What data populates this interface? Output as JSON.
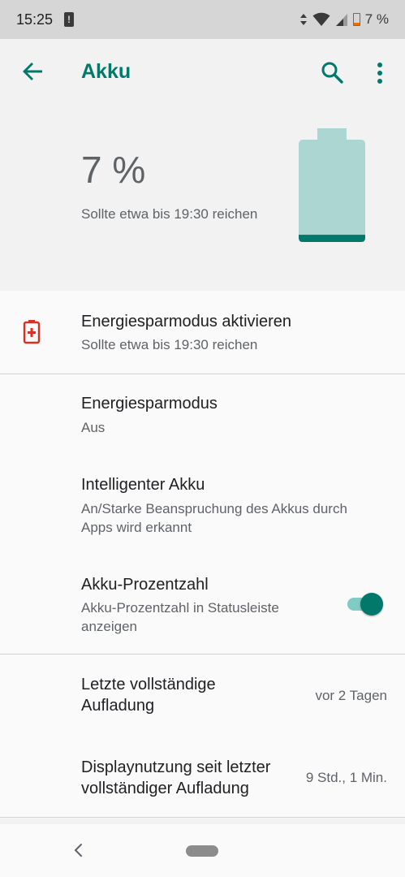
{
  "status_bar": {
    "time": "15:25",
    "battery_percent": "7 %",
    "icons": [
      "alert-icon",
      "data-arrows-icon",
      "wifi-icon",
      "signal-icon",
      "battery-icon"
    ]
  },
  "toolbar": {
    "title": "Akku",
    "back_icon": "arrow-left-icon",
    "search_icon": "search-icon",
    "more_icon": "more-vert-icon"
  },
  "header": {
    "percent": "7 %",
    "estimate": "Sollte etwa bis 19:30 reichen",
    "battery_level": 0.07
  },
  "items": [
    {
      "title": "Energiesparmodus aktivieren",
      "subtitle": "Sollte etwa bis 19:30 reichen",
      "icon": "battery-alert-icon"
    },
    {
      "title": "Energiesparmodus",
      "subtitle": "Aus"
    },
    {
      "title": "Intelligenter Akku",
      "subtitle_line1": "An/Starke Beanspruchung des Akkus durch",
      "subtitle_line2": "Apps wird erkannt"
    },
    {
      "title": "Akku-Prozentzahl",
      "subtitle_line1": "Akku-Prozentzahl in Statusleiste",
      "subtitle_line2": "anzeigen",
      "toggle_on": true
    },
    {
      "title_line1": "Letzte vollständige",
      "title_line2": "Aufladung",
      "value": "vor 2 Tagen"
    },
    {
      "title_line1": "Displaynutzung seit letzter",
      "title_line2": "vollständiger Aufladung",
      "value": "9 Std., 1 Min."
    }
  ],
  "colors": {
    "accent": "#00796b",
    "accent_light": "#80cbc4",
    "battery_fill": "#acd6d1",
    "warning": "#d93025"
  }
}
